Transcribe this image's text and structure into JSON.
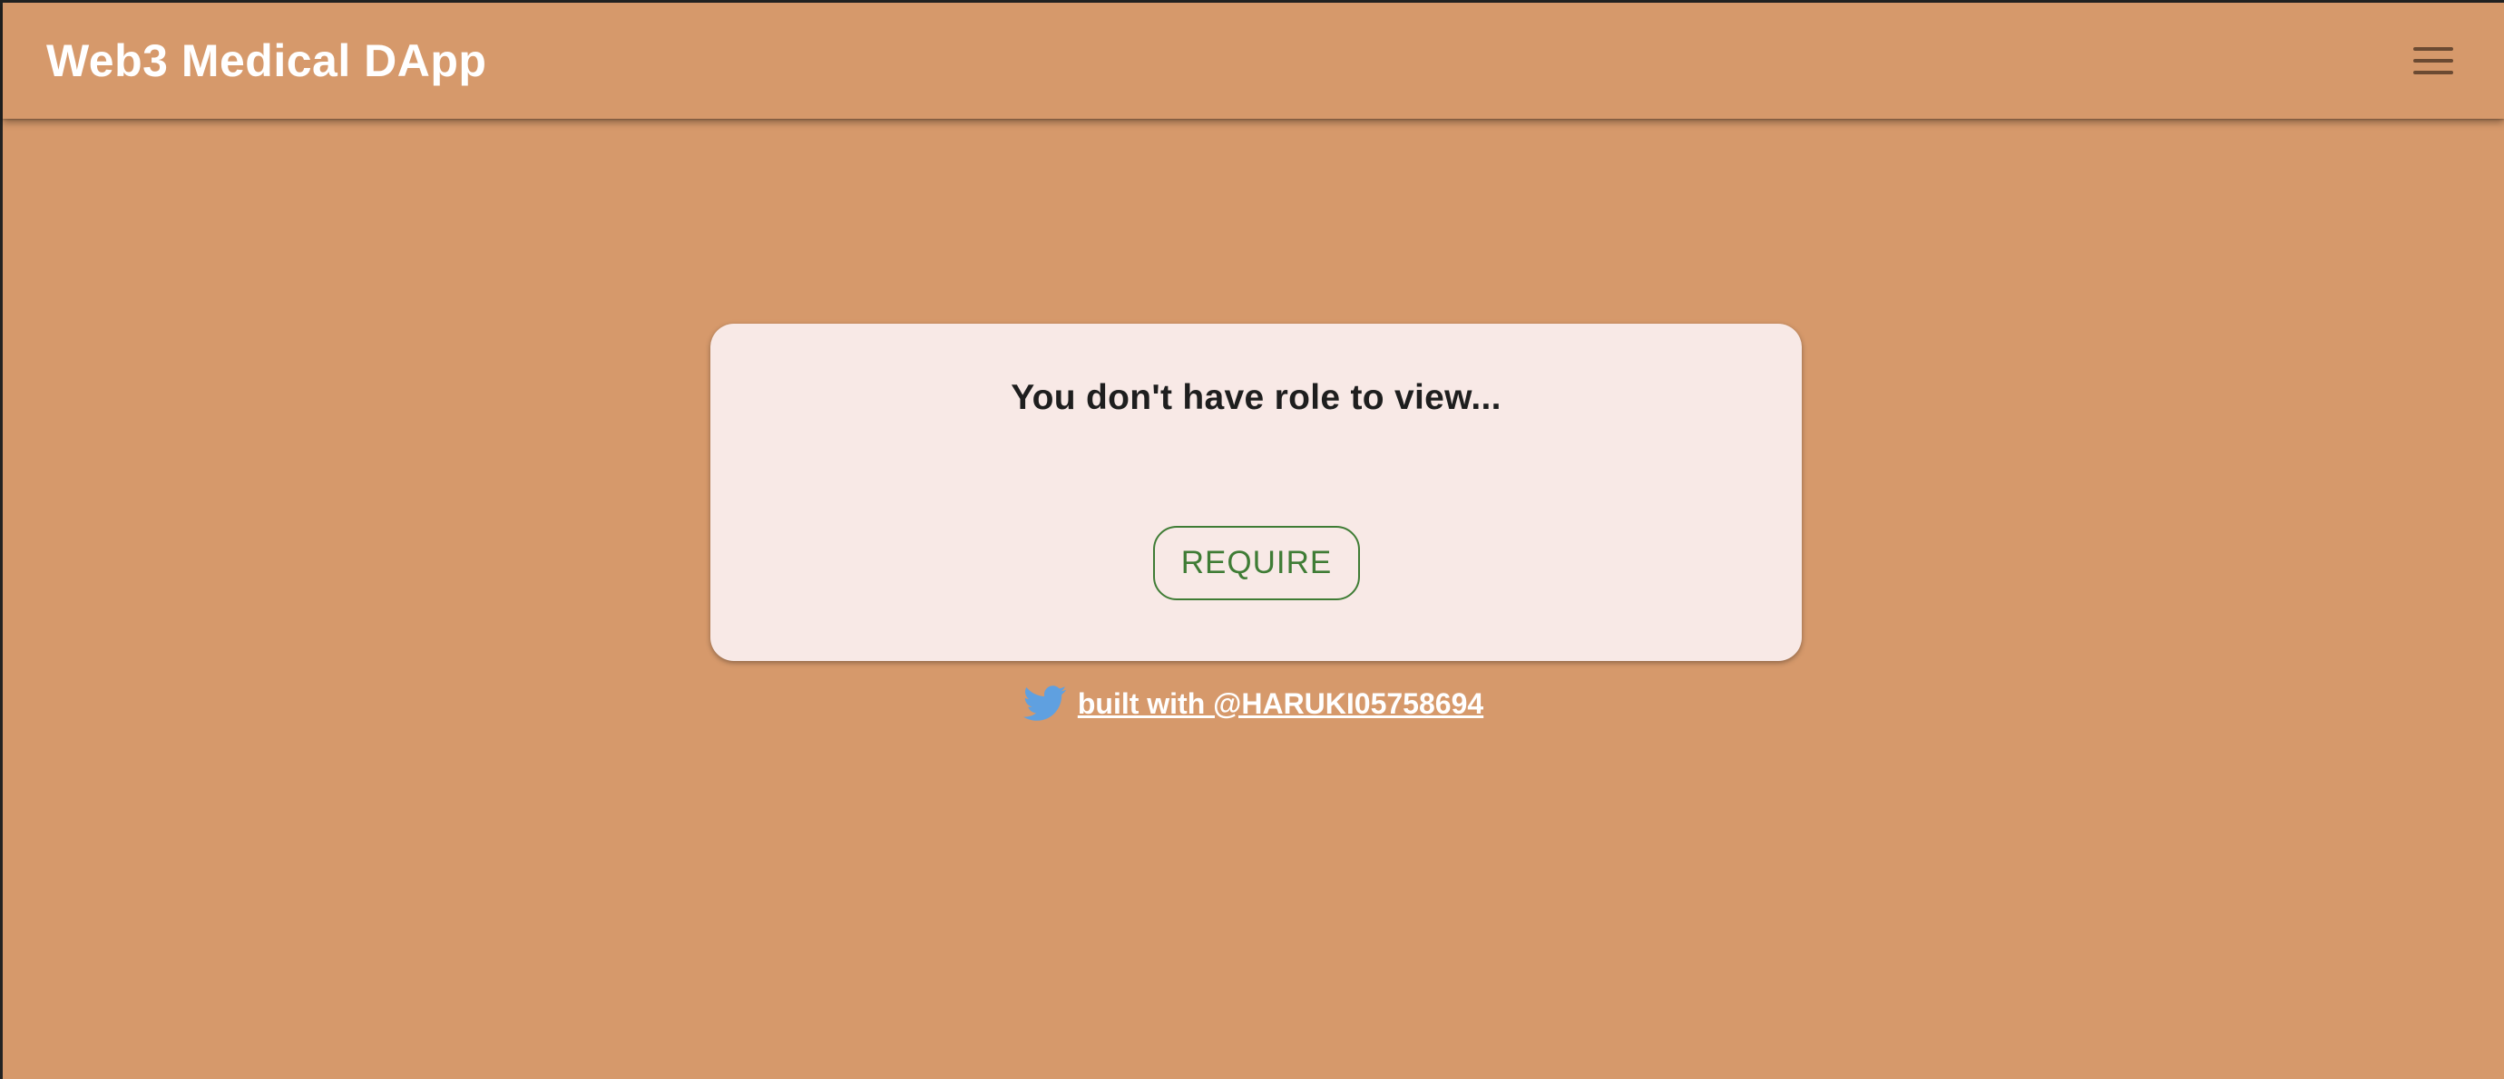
{
  "appbar": {
    "title": "Web3 Medical DApp",
    "menu_icon": "hamburger-menu-icon"
  },
  "card": {
    "message": "You don't have role to view...",
    "require_label": "REQUIRE"
  },
  "footer": {
    "icon": "twitter-icon",
    "link_text": "built with @HARUKI05758694"
  },
  "colors": {
    "background": "#d6996b",
    "card_background": "#f8e9e6",
    "button_accent": "#3f7c35",
    "twitter_blue": "#5fa0e0",
    "menu_icon": "#6b4a32"
  }
}
